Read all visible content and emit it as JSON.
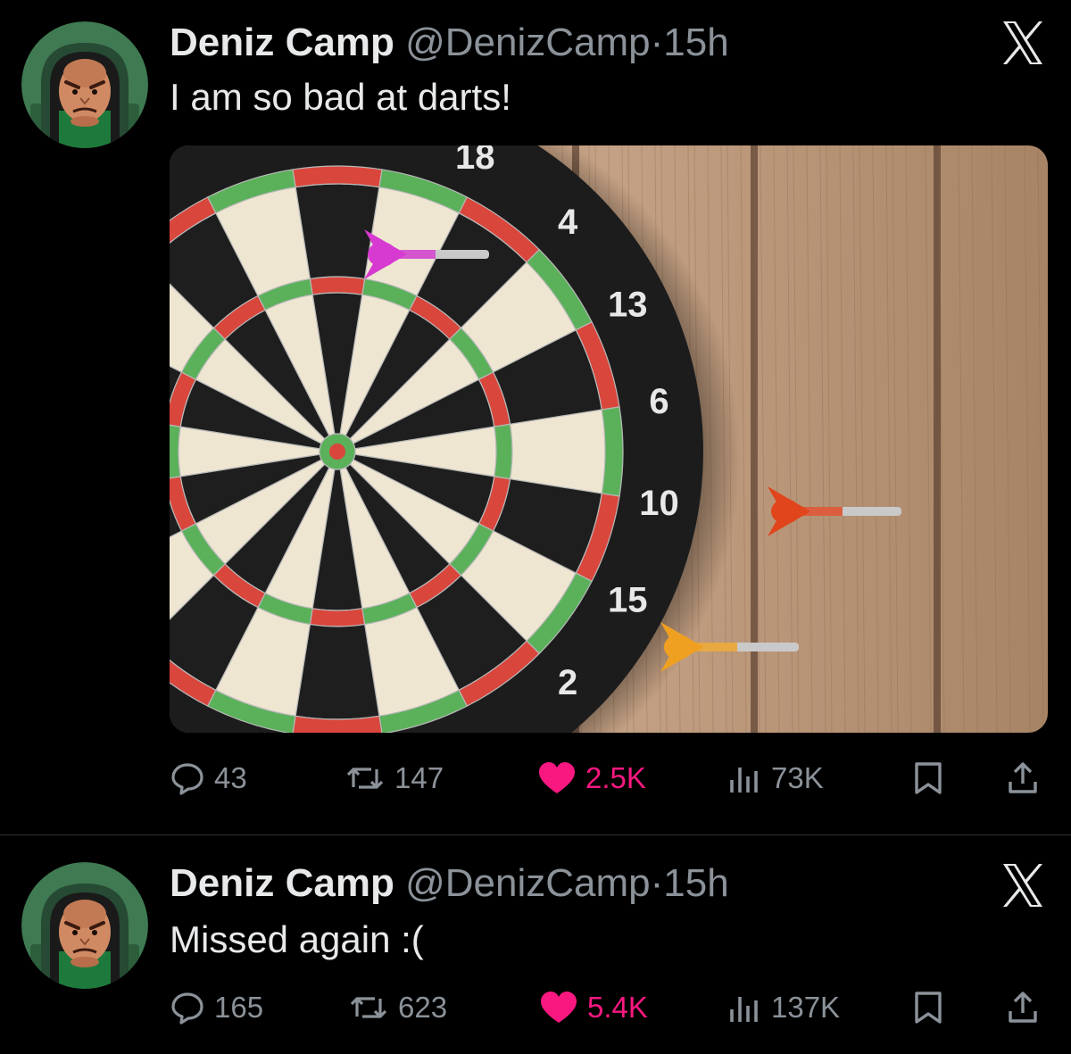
{
  "tweets": [
    {
      "author": {
        "name": "Deniz Camp",
        "handle": "@DenizCamp"
      },
      "separator": "·",
      "time": "15h",
      "text": "I am so bad at darts!",
      "media": {
        "board_numbers": [
          "18",
          "4",
          "13",
          "6",
          "10",
          "15",
          "2"
        ],
        "dart_colors": [
          "#d63ad0",
          "#e0451c",
          "#f0a020"
        ]
      },
      "stats": {
        "replies": "43",
        "reposts": "147",
        "likes": "2.5K",
        "views": "73K"
      }
    },
    {
      "author": {
        "name": "Deniz Camp",
        "handle": "@DenizCamp"
      },
      "separator": "·",
      "time": "15h",
      "text": "Missed again :(",
      "stats": {
        "replies": "165",
        "reposts": "623",
        "likes": "5.4K",
        "views": "137K"
      }
    }
  ],
  "icons": {
    "platform": "x-logo-icon",
    "reply": "speech-bubble-icon",
    "repost": "repost-arrows-icon",
    "like": "heart-icon",
    "views": "bar-chart-icon",
    "bookmark": "bookmark-icon",
    "share": "share-upload-icon"
  },
  "colors": {
    "background": "#000000",
    "text": "#e7e9ea",
    "secondary": "#8b9299",
    "like": "#f91880",
    "avatar_bg": "#3f7a52"
  }
}
